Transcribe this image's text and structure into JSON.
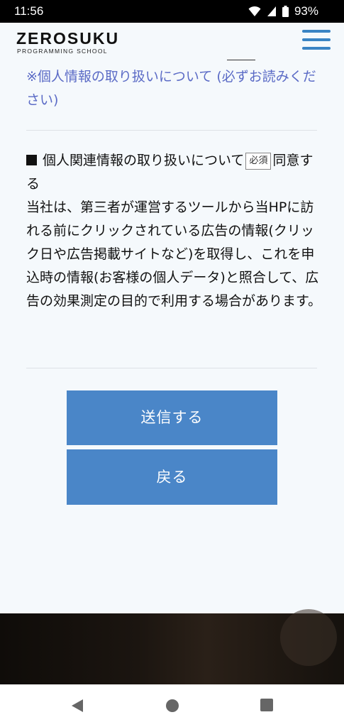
{
  "status_bar": {
    "time": "11:56",
    "battery": "93%"
  },
  "header": {
    "logo_main": "ZEROSUKU",
    "logo_sub": "PROGRAMMING SCHOOL"
  },
  "privacy_link": "※個人情報の取り扱いについて (必ずお読みください)",
  "consent": {
    "heading": "個人関連情報の取り扱いについて",
    "badge": "必須",
    "agree": "同意する",
    "body": "当社は、第三者が運営するツールから当HPに訪れる前にクリックされている広告の情報(クリック日や広告掲載サイトなど)を取得し、これを申込時の情報(お客様の個人データ)と照合して、広告の効果測定の目的で利用する場合があります。"
  },
  "buttons": {
    "submit": "送信する",
    "back": "戻る"
  },
  "colors": {
    "accent": "#4a86c8",
    "link": "#5b6bc6",
    "menu": "#3a84c4"
  },
  "icons": [
    "wifi-icon",
    "signal-icon",
    "battery-icon",
    "hamburger-menu-icon",
    "back-icon",
    "home-icon",
    "recents-icon"
  ]
}
